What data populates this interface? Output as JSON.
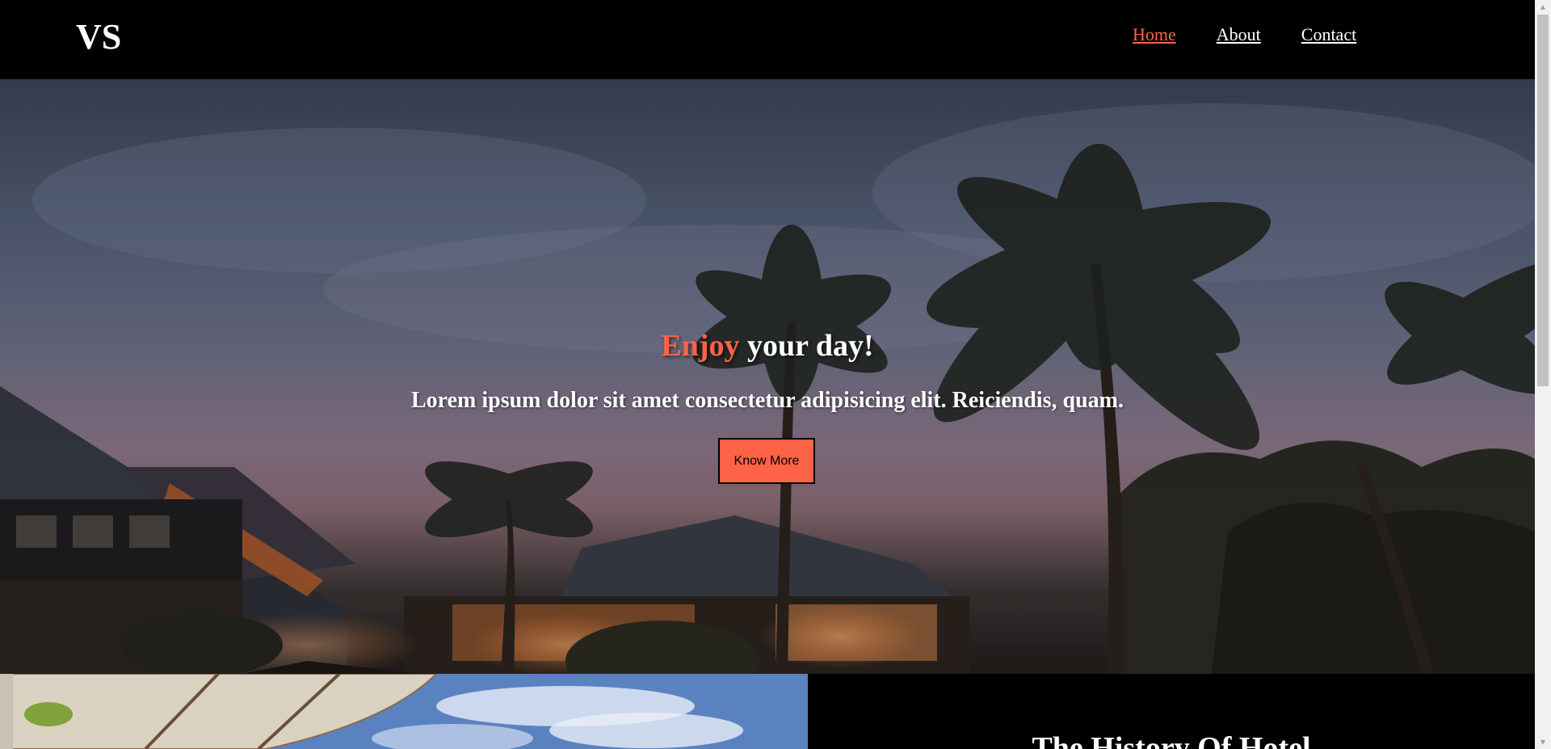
{
  "header": {
    "logo": "VS",
    "nav": [
      {
        "label": "Home",
        "active": true
      },
      {
        "label": "About",
        "active": false
      },
      {
        "label": "Contact",
        "active": false
      }
    ]
  },
  "hero": {
    "title_accent": "Enjoy",
    "title_rest": " your day!",
    "subtitle": "Lorem ipsum dolor sit amet consectetur adipisicing elit. Reiciendis, quam.",
    "button_label": "Know More"
  },
  "history": {
    "title": "The History Of Hotel"
  },
  "colors": {
    "accent": "#ff6347",
    "header_bg": "#000000",
    "text": "#ffffff"
  }
}
